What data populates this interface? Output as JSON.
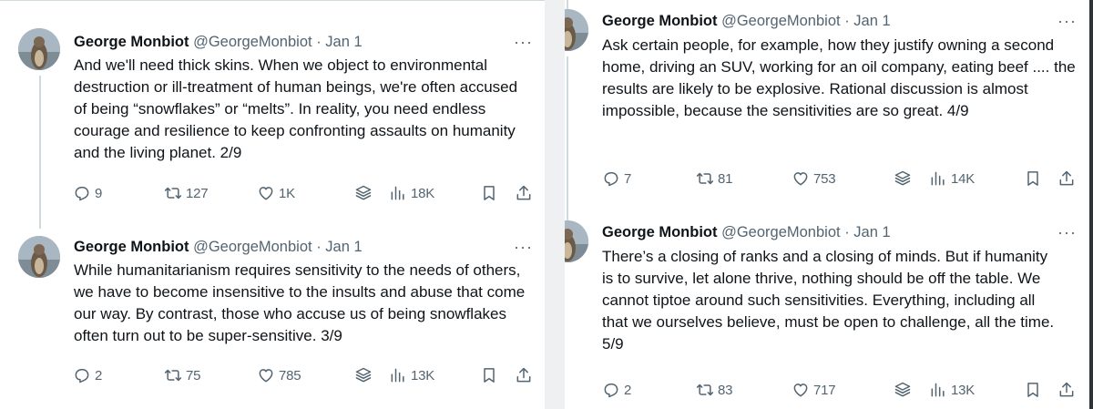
{
  "tweets": [
    {
      "name": "George Monbiot",
      "handle": "@GeorgeMonbiot",
      "separator": "·",
      "date": "Jan 1",
      "text": "And we'll need thick skins. When we object to environmental destruction or ill-treatment of human beings, we're often accused of being “snowflakes” or “melts”. In reality, you need endless courage and resilience to keep confronting assaults on humanity and the living planet. 2/9",
      "replies": "9",
      "reposts": "127",
      "likes": "1K",
      "views": "18K"
    },
    {
      "name": "George Monbiot",
      "handle": "@GeorgeMonbiot",
      "separator": "·",
      "date": "Jan 1",
      "text": "While humanitarianism requires sensitivity to the needs of others, we have to become insensitive to the insults and abuse that come our way. By contrast, those who accuse us of being snowflakes often turn out to be super-sensitive. 3/9",
      "replies": "2",
      "reposts": "75",
      "likes": "785",
      "views": "13K"
    },
    {
      "name": "George Monbiot",
      "handle": "@GeorgeMonbiot",
      "separator": "·",
      "date": "Jan 1",
      "text": "Ask certain people, for example, how they justify owning a second home, driving an SUV, working for an oil company, eating beef .... the results are likely to be explosive. Rational discussion is almost impossible, because the sensitivities are so great. 4/9",
      "replies": "7",
      "reposts": "81",
      "likes": "753",
      "views": "14K"
    },
    {
      "name": "George Monbiot",
      "handle": "@GeorgeMonbiot",
      "separator": "·",
      "date": "Jan 1",
      "text": "There’s a closing of ranks and a closing of minds. But if humanity is to survive, let alone thrive, nothing should be off the table. We cannot tiptoe around such sensitivities. Everything, including all that we ourselves believe, must be open to challenge, all the time. 5/9",
      "replies": "2",
      "reposts": "83",
      "likes": "717",
      "views": "13K"
    }
  ],
  "more_glyph": "···",
  "icons": [
    "reply-icon",
    "repost-icon",
    "like-icon",
    "grok-icon",
    "views-icon",
    "bookmark-icon",
    "share-icon"
  ],
  "colors": {
    "text": "#0f1419",
    "muted": "#536471",
    "divider": "#cfd9de"
  }
}
